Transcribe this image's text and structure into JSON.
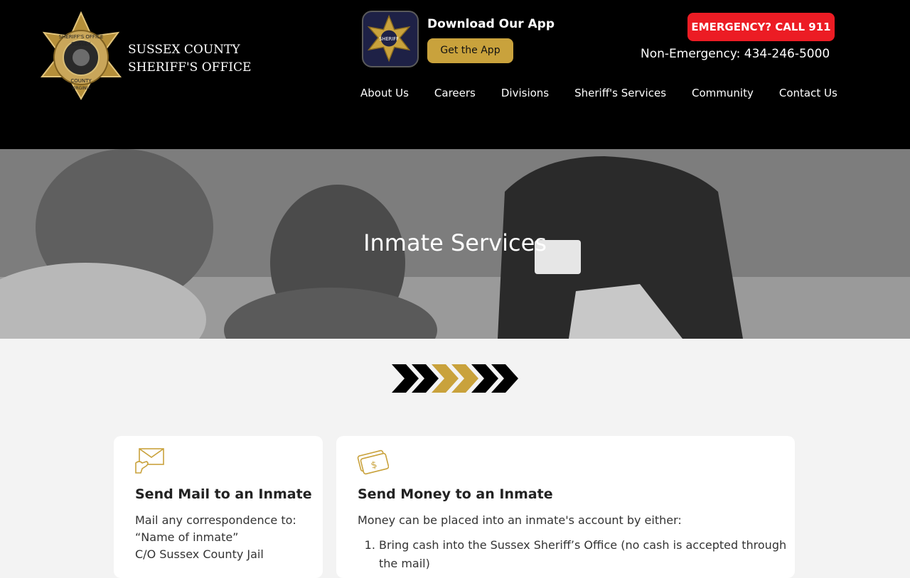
{
  "header": {
    "logo": {
      "icon": "sheriff-badge-icon",
      "badge_text": [
        "SHERIFF'S OFFICE",
        "SUSSEX",
        "COUNTY",
        "VIRGINIA"
      ]
    },
    "org_name_line1": "SUSSEX COUNTY",
    "org_name_line2": "SHERIFF'S OFFICE",
    "app": {
      "icon": "sheriff-star-icon",
      "icon_text": "SHERIFF",
      "title": "Download Our App",
      "button_label": "Get the App"
    },
    "emergency_label": "EMERGENCY? CALL 911",
    "non_emergency": "Non-Emergency: 434-246-5000",
    "nav": [
      "About Us",
      "Careers",
      "Divisions",
      "Sheriff's Services",
      "Community",
      "Contact Us"
    ]
  },
  "hero": {
    "title": "Inmate Services"
  },
  "divider": {
    "icon": "chevron-divider-icon",
    "colors": [
      "#000000",
      "#000000",
      "#c9a23c",
      "#c9a23c",
      "#000000",
      "#000000"
    ]
  },
  "cards": {
    "mail": {
      "icon": "envelope-hand-icon",
      "title": "Send Mail to an Inmate",
      "lines": [
        "Mail any correspondence to:",
        "“Name of inmate”",
        "C/O Sussex County Jail"
      ]
    },
    "money": {
      "icon": "money-icon",
      "title": "Send Money to an Inmate",
      "intro": "Money can be placed into an inmate's account by either:",
      "items": [
        "Bring cash into the Sussex Sheriff’s Office (no cash is accepted through the mail)"
      ]
    }
  },
  "colors": {
    "header_bg": "#000000",
    "gold": "#c9a23c",
    "emergency_red": "#ec1c24",
    "page_bg": "#f3f3f3",
    "card_bg": "#ffffff"
  }
}
